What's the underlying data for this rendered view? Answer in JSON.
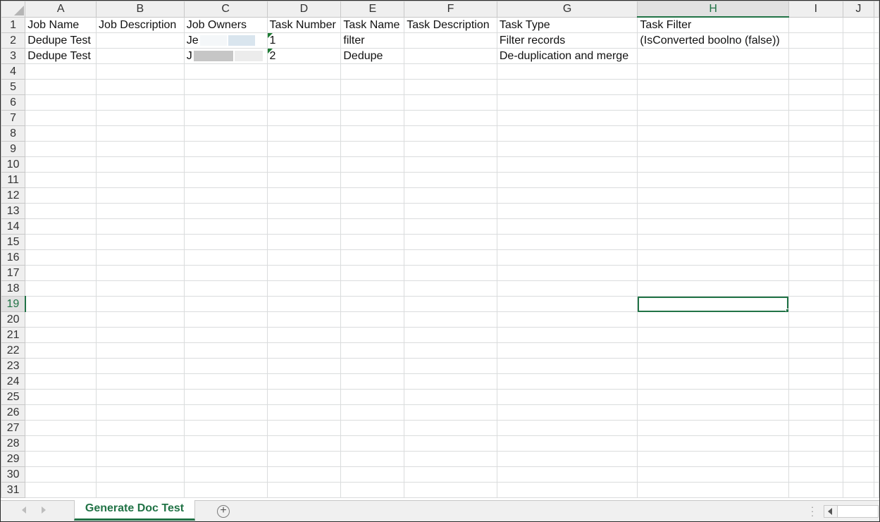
{
  "columns": [
    "A",
    "B",
    "C",
    "D",
    "E",
    "F",
    "G",
    "H",
    "I",
    "J"
  ],
  "active_column": "H",
  "active_row": 19,
  "row_count": 31,
  "rows": [
    [
      "Job Name",
      "Job Description",
      "Job Owners",
      "Task Number",
      "Task Name",
      "Task Description",
      "Task Type",
      "Task Filter",
      "",
      ""
    ],
    [
      "Dedupe Test",
      "",
      "Je",
      "1",
      "filter",
      "",
      "Filter records",
      "(IsConverted boolno (false))",
      "",
      ""
    ],
    [
      "Dedupe Test",
      "",
      "J",
      "2",
      "Dedupe",
      "",
      "De-duplication and merge",
      "",
      "",
      ""
    ]
  ],
  "number_stored_as_text_cells": [
    "D2",
    "D3"
  ],
  "sheet_tab": {
    "label": "Generate Doc Test"
  },
  "accent_color": "#217346"
}
